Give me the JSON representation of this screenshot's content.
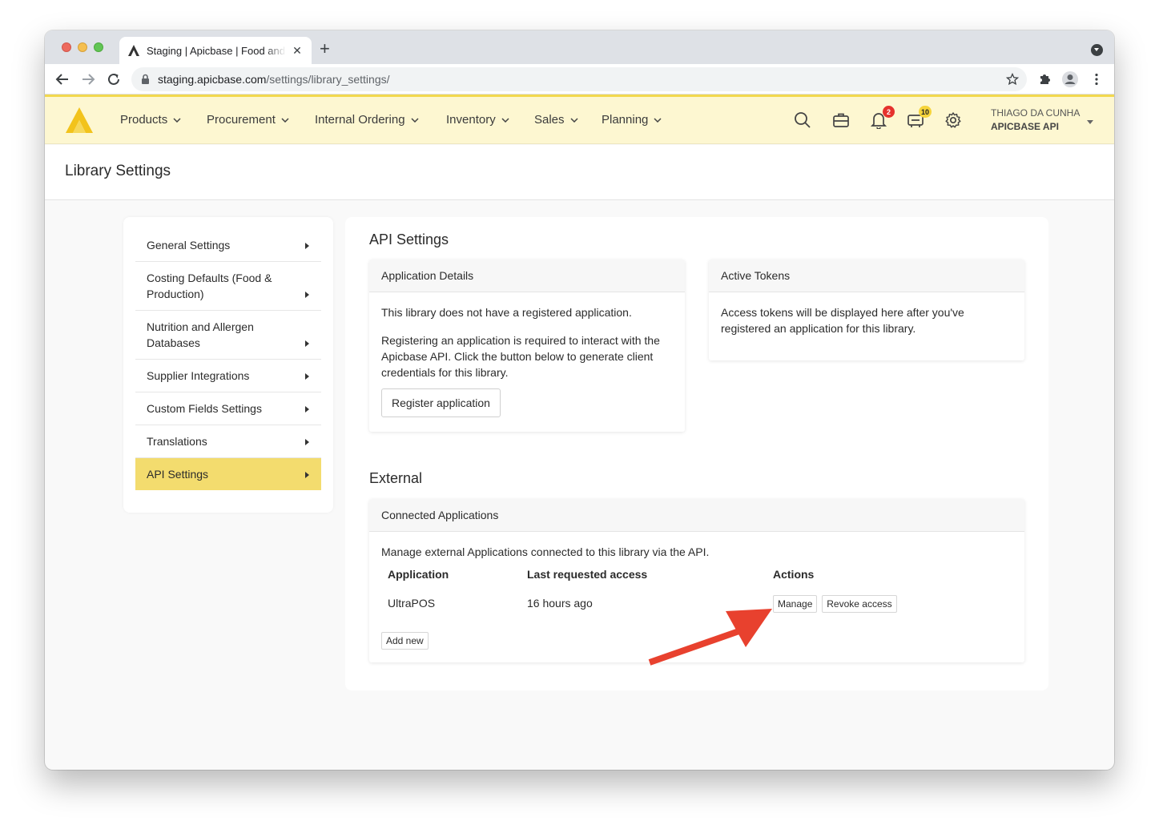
{
  "browser": {
    "tab_title": "Staging | Apicbase | Food and Beverage",
    "tab_favicon_letter": "A",
    "url_host": "staging.apicbase.com",
    "url_path": "/settings/library_settings/"
  },
  "header": {
    "nav": [
      {
        "label": "Products"
      },
      {
        "label": "Procurement"
      },
      {
        "label": "Internal Ordering"
      },
      {
        "label": "Inventory"
      },
      {
        "label": "Sales"
      },
      {
        "label": "Planning"
      }
    ],
    "notifications_count": "2",
    "orders_count": "10",
    "user_name": "THIAGO DA CUNHA",
    "user_company": "APICBASE API",
    "accent_color": "#f2d84e",
    "header_bg": "#fdf7d1"
  },
  "page": {
    "title": "Library Settings"
  },
  "sidebar": {
    "items": [
      {
        "label": "General Settings"
      },
      {
        "label": "Costing Defaults (Food & Production)"
      },
      {
        "label": "Nutrition and Allergen Databases"
      },
      {
        "label": "Supplier Integrations"
      },
      {
        "label": "Custom Fields Settings"
      },
      {
        "label": "Translations"
      },
      {
        "label": "API Settings"
      }
    ],
    "active_index": 6,
    "active_color": "#f3dc6e"
  },
  "api_settings": {
    "title": "API Settings",
    "application_details": {
      "heading": "Application Details",
      "text1": "This library does not have a registered application.",
      "text2": "Registering an application is required to interact with the Apicbase API. Click the button below to generate client credentials for this library.",
      "button": "Register application"
    },
    "active_tokens": {
      "heading": "Active Tokens",
      "text": "Access tokens will be displayed here after you've registered an application for this library."
    }
  },
  "external": {
    "title": "External",
    "panel_heading": "Connected Applications",
    "description": "Manage external Applications connected to this library via the API.",
    "columns": [
      "Application",
      "Last requested access",
      "Actions"
    ],
    "rows": [
      {
        "application": "UltraPOS",
        "last_access": "16 hours ago",
        "manage": "Manage",
        "revoke": "Revoke access"
      }
    ],
    "add_new": "Add new"
  },
  "annotation_color": "#e8412e"
}
